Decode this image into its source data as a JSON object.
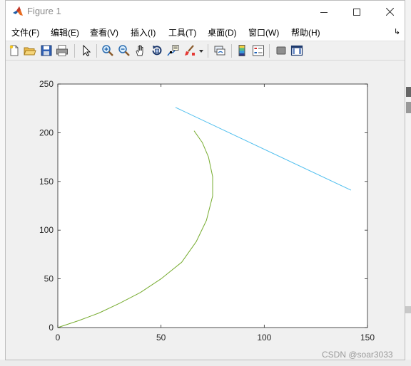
{
  "window": {
    "title": "Figure 1",
    "icon": "matlab-logo-icon"
  },
  "menu": {
    "items": [
      {
        "label": "文件(F)"
      },
      {
        "label": "编辑(E)"
      },
      {
        "label": "查看(V)"
      },
      {
        "label": "插入(I)"
      },
      {
        "label": "工具(T)"
      },
      {
        "label": "桌面(D)"
      },
      {
        "label": "窗口(W)"
      },
      {
        "label": "帮助(H)"
      }
    ],
    "corner_icon": "dock-arrow-icon"
  },
  "toolbar": {
    "buttons": [
      "new-figure-icon",
      "open-file-icon",
      "save-icon",
      "print-icon",
      "pointer-icon",
      "zoom-in-icon",
      "zoom-out-icon",
      "pan-icon",
      "rotate-3d-icon",
      "data-cursor-icon",
      "brush-icon",
      "link-plot-icon",
      "colorbar-icon",
      "legend-icon",
      "hide-plot-tools-icon",
      "show-plot-tools-icon"
    ]
  },
  "chart_data": {
    "type": "line",
    "title": "",
    "xlabel": "",
    "ylabel": "",
    "xlim": [
      0,
      150
    ],
    "ylim": [
      0,
      250
    ],
    "xticks": [
      0,
      50,
      100,
      150
    ],
    "yticks": [
      0,
      50,
      100,
      150,
      200,
      250
    ],
    "grid": false,
    "legend": "none",
    "series": [
      {
        "color": "#77ac30",
        "points": [
          [
            0,
            0
          ],
          [
            10,
            7
          ],
          [
            20,
            15
          ],
          [
            30,
            25
          ],
          [
            40,
            36
          ],
          [
            50,
            50
          ],
          [
            60,
            67
          ],
          [
            67,
            88
          ],
          [
            72,
            110
          ],
          [
            75,
            135
          ],
          [
            75,
            155
          ],
          [
            73,
            175
          ],
          [
            70,
            190
          ],
          [
            66,
            202
          ]
        ]
      },
      {
        "color": "#4dbeee",
        "points": [
          [
            57,
            226
          ],
          [
            142,
            141
          ]
        ]
      }
    ]
  },
  "watermark": "CSDN @soar3033"
}
